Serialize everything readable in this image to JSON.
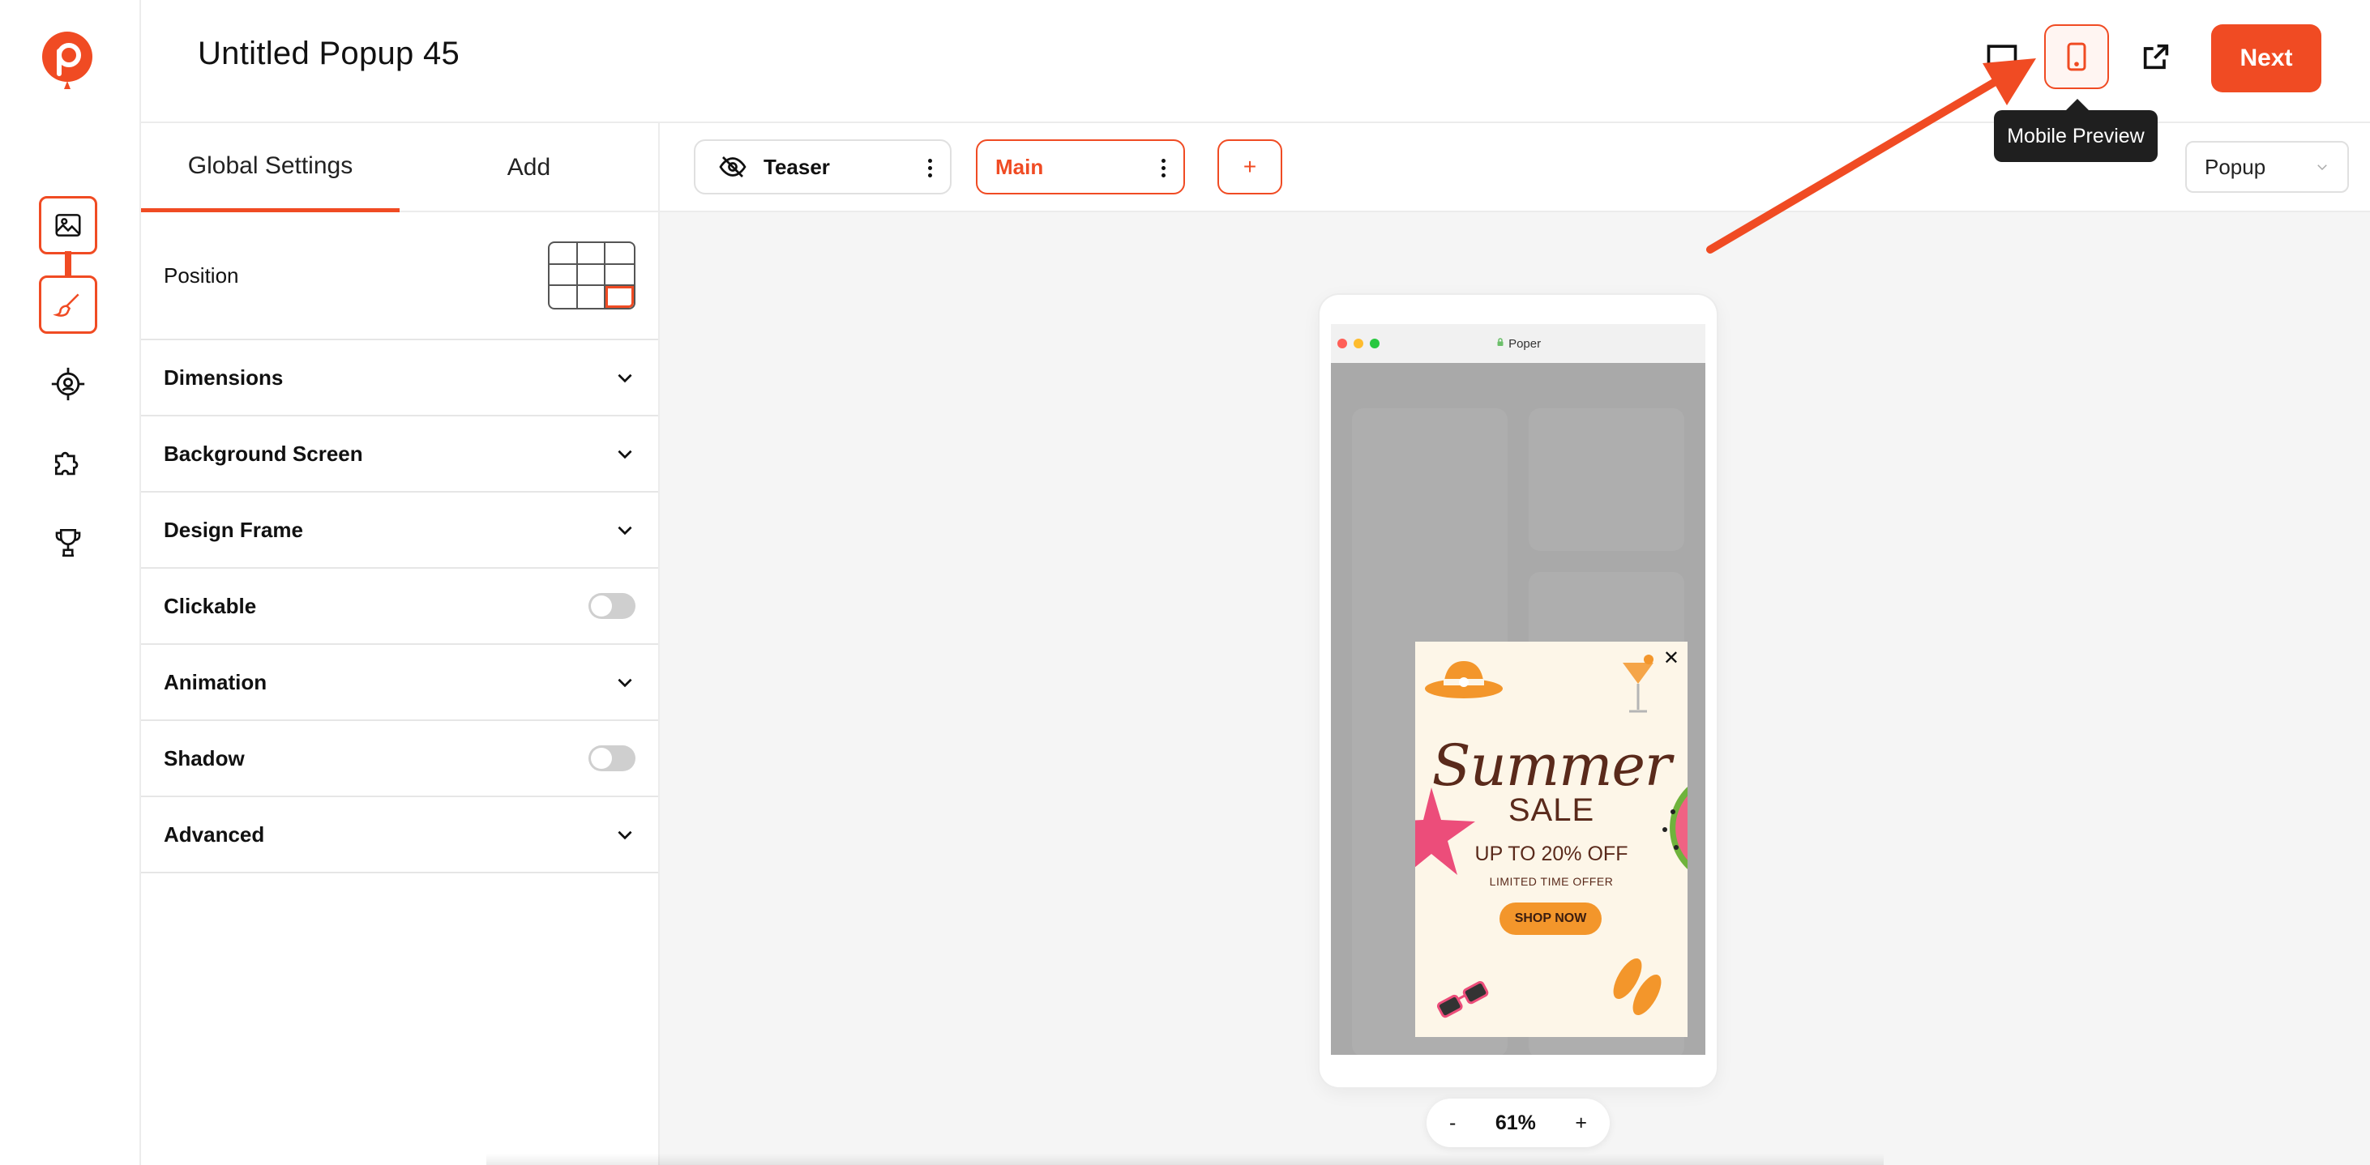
{
  "app": {
    "title": "Untitled Popup 45",
    "brand_color": "#f04b23"
  },
  "header": {
    "icons": [
      "desktop-preview-icon",
      "mobile-preview-icon",
      "external-link-icon"
    ],
    "next_label": "Next",
    "tooltip": "Mobile Preview"
  },
  "rail": {
    "items": [
      "image-icon",
      "brush-icon",
      "target-icon",
      "puzzle-icon",
      "trophy-icon"
    ]
  },
  "panel": {
    "tabs": [
      {
        "label": "Global Settings",
        "active": true
      },
      {
        "label": "Add",
        "active": false
      }
    ],
    "position_label": "Position",
    "sections": [
      {
        "label": "Dimensions",
        "control": "chevron"
      },
      {
        "label": "Background Screen",
        "control": "chevron"
      },
      {
        "label": "Design Frame",
        "control": "chevron"
      },
      {
        "label": "Clickable",
        "control": "toggle"
      },
      {
        "label": "Animation",
        "control": "chevron"
      },
      {
        "label": "Shadow",
        "control": "toggle"
      },
      {
        "label": "Advanced",
        "control": "chevron"
      }
    ]
  },
  "steps": {
    "teaser": "Teaser",
    "main": "Main",
    "add": "+",
    "type_select": "Popup"
  },
  "preview": {
    "url": "Poper",
    "popup": {
      "headline": "Summer",
      "subheadline": "SALE",
      "offer": "UP TO 20% OFF",
      "note": "LIMITED TIME OFFER",
      "cta": "SHOP NOW",
      "close": "✕"
    }
  },
  "zoom": {
    "minus": "-",
    "value": "61%",
    "plus": "+"
  }
}
